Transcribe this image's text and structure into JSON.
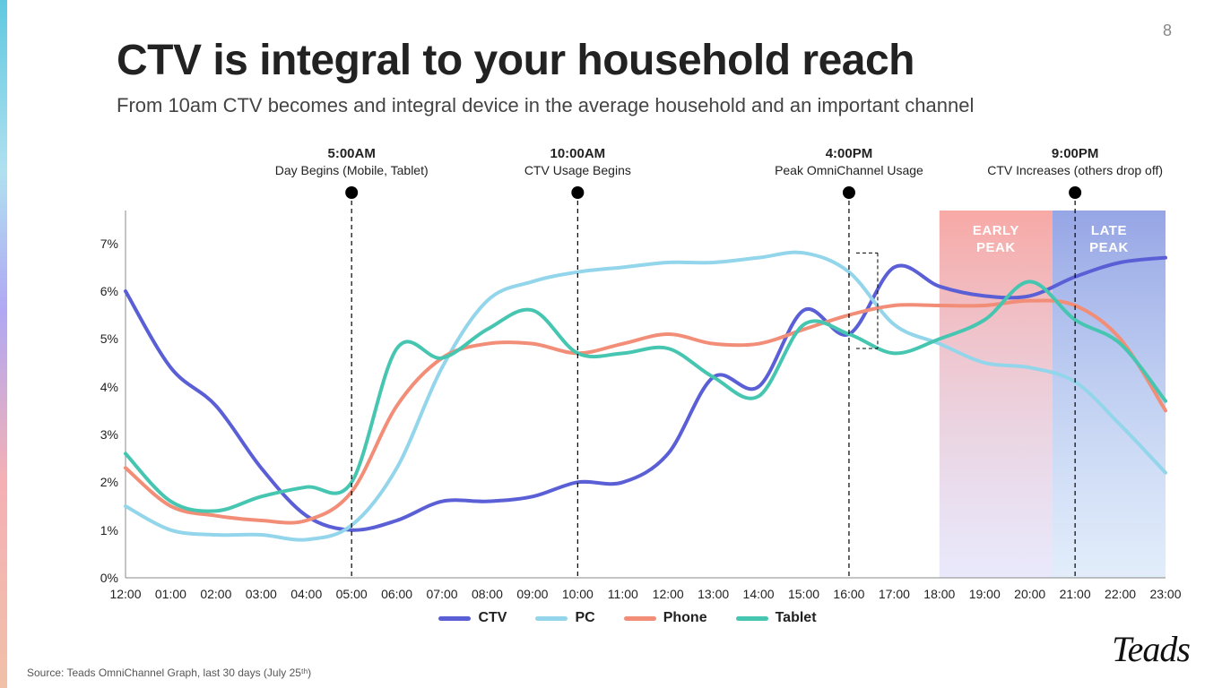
{
  "page_number": "8",
  "title": "CTV is integral to your household reach",
  "subtitle": "From 10am CTV becomes and integral device in the average household and an important channel",
  "source": "Source: Teads OmniChannel Graph, last 30 days (July 25ᵗʰ)",
  "brand": "Teads",
  "annotations": [
    {
      "time": "5:00AM",
      "text": "Day Begins (Mobile, Tablet)",
      "xindex": 5
    },
    {
      "time": "10:00AM",
      "text": "CTV Usage Begins",
      "xindex": 10
    },
    {
      "time": "4:00PM",
      "text": "Peak OmniChannel Usage",
      "xindex": 16
    },
    {
      "time": "9:00PM",
      "text": "CTV Increases (others drop off)",
      "xindex": 21
    }
  ],
  "peak_bands": [
    {
      "label": "EARLY PEAK",
      "from": 18,
      "to": 20.5,
      "grad": [
        "rgba(245,140,135,0.75)",
        "rgba(200,200,245,0.40)"
      ]
    },
    {
      "label": "LATE PEAK",
      "from": 20.5,
      "to": 23,
      "grad": [
        "rgba(115,135,220,0.75)",
        "rgba(160,195,240,0.30)"
      ]
    }
  ],
  "legend": [
    {
      "name": "CTV",
      "color": "#5a5fd6"
    },
    {
      "name": "PC",
      "color": "#93d5ea"
    },
    {
      "name": "Phone",
      "color": "#f28e77"
    },
    {
      "name": "Tablet",
      "color": "#46c6b1"
    }
  ],
  "chart_data": {
    "type": "line",
    "xlabel": "",
    "ylabel": "",
    "ylim": [
      0,
      7.5
    ],
    "y_ticks": [
      "0%",
      "1%",
      "2%",
      "3%",
      "4%",
      "5%",
      "6%",
      "7%"
    ],
    "categories": [
      "12:00",
      "01:00",
      "02:00",
      "03:00",
      "04:00",
      "05:00",
      "06:00",
      "07:00",
      "08:00",
      "09:00",
      "10:00",
      "11:00",
      "12:00",
      "13:00",
      "14:00",
      "15:00",
      "16:00",
      "17:00",
      "18:00",
      "19:00",
      "20:00",
      "21:00",
      "22:00",
      "23:00"
    ],
    "series": [
      {
        "name": "CTV",
        "color": "#5a5fd6",
        "values": [
          6.0,
          4.4,
          3.6,
          2.3,
          1.3,
          1.0,
          1.2,
          1.6,
          1.6,
          1.7,
          2.0,
          2.0,
          2.6,
          4.2,
          4.0,
          5.6,
          5.1,
          6.5,
          6.1,
          5.9,
          5.9,
          6.3,
          6.6,
          6.7
        ]
      },
      {
        "name": "PC",
        "color": "#93d5ea",
        "values": [
          1.5,
          1.0,
          0.9,
          0.9,
          0.8,
          1.1,
          2.3,
          4.4,
          5.8,
          6.2,
          6.4,
          6.5,
          6.6,
          6.6,
          6.7,
          6.8,
          6.4,
          5.3,
          4.9,
          4.5,
          4.4,
          4.1,
          3.2,
          2.2
        ]
      },
      {
        "name": "Phone",
        "color": "#f28e77",
        "values": [
          2.3,
          1.5,
          1.3,
          1.2,
          1.2,
          1.8,
          3.6,
          4.6,
          4.9,
          4.9,
          4.7,
          4.9,
          5.1,
          4.9,
          4.9,
          5.2,
          5.5,
          5.7,
          5.7,
          5.7,
          5.8,
          5.7,
          5.0,
          3.5
        ]
      },
      {
        "name": "Tablet",
        "color": "#46c6b1",
        "values": [
          2.6,
          1.6,
          1.4,
          1.7,
          1.9,
          2.0,
          4.8,
          4.6,
          5.2,
          5.6,
          4.7,
          4.7,
          4.8,
          4.2,
          3.8,
          5.3,
          5.1,
          4.7,
          5.0,
          5.4,
          6.2,
          5.4,
          4.9,
          3.7
        ]
      }
    ],
    "bracket": {
      "x": 16,
      "ymin": 4.8,
      "ymax": 6.8
    }
  }
}
